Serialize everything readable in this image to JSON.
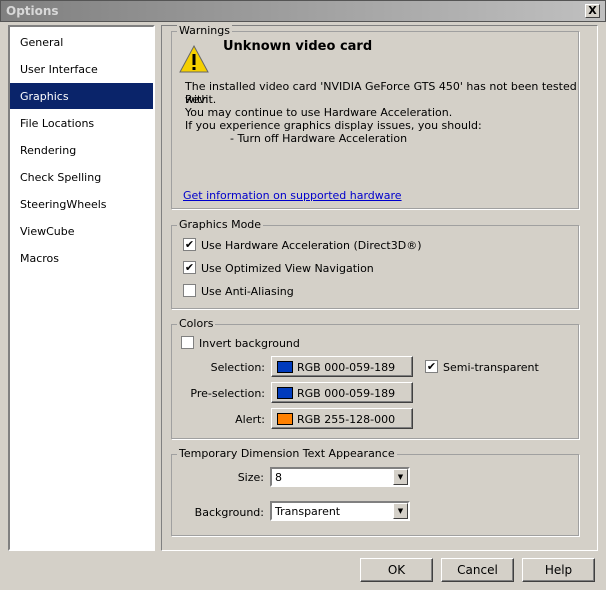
{
  "window": {
    "title": "Options",
    "close": "X"
  },
  "nav": {
    "items": [
      {
        "label": "General"
      },
      {
        "label": "User Interface"
      },
      {
        "label": "Graphics"
      },
      {
        "label": "File Locations"
      },
      {
        "label": "Rendering"
      },
      {
        "label": "Check Spelling"
      },
      {
        "label": "SteeringWheels"
      },
      {
        "label": "ViewCube"
      },
      {
        "label": "Macros"
      }
    ],
    "selected": "Graphics"
  },
  "warnings": {
    "legend": "Warnings",
    "heading": "Unknown video card",
    "line1": "The installed video card 'NVIDIA GeForce GTS 450' has not been tested with",
    "line2": "Revit.",
    "line3": "You may continue to use Hardware Acceleration.",
    "line4": "If you experience graphics display issues, you should:",
    "line5": "- Turn off Hardware Acceleration",
    "link": "Get information on supported hardware"
  },
  "graphics_mode": {
    "legend": "Graphics Mode",
    "hw_accel": {
      "label": "Use Hardware Acceleration (Direct3D®)",
      "checked": true
    },
    "opt_nav": {
      "label": "Use Optimized View Navigation",
      "checked": true
    },
    "anti_alias": {
      "label": "Use Anti-Aliasing",
      "checked": false
    }
  },
  "colors": {
    "legend": "Colors",
    "invert": {
      "label": "Invert background",
      "checked": false
    },
    "selection": {
      "label": "Selection:",
      "value": "RGB 000-059-189",
      "color": "#003bbd"
    },
    "preselection": {
      "label": "Pre-selection:",
      "value": "RGB 000-059-189",
      "color": "#003bbd"
    },
    "alert": {
      "label": "Alert:",
      "value": "RGB 255-128-000",
      "color": "#ff8000"
    },
    "semi_transparent": {
      "label": "Semi-transparent",
      "checked": true
    }
  },
  "temp_dim": {
    "legend": "Temporary Dimension Text Appearance",
    "size_label": "Size:",
    "size_value": "8",
    "bg_label": "Background:",
    "bg_value": "Transparent"
  },
  "buttons": {
    "ok": "OK",
    "cancel": "Cancel",
    "help": "Help"
  }
}
